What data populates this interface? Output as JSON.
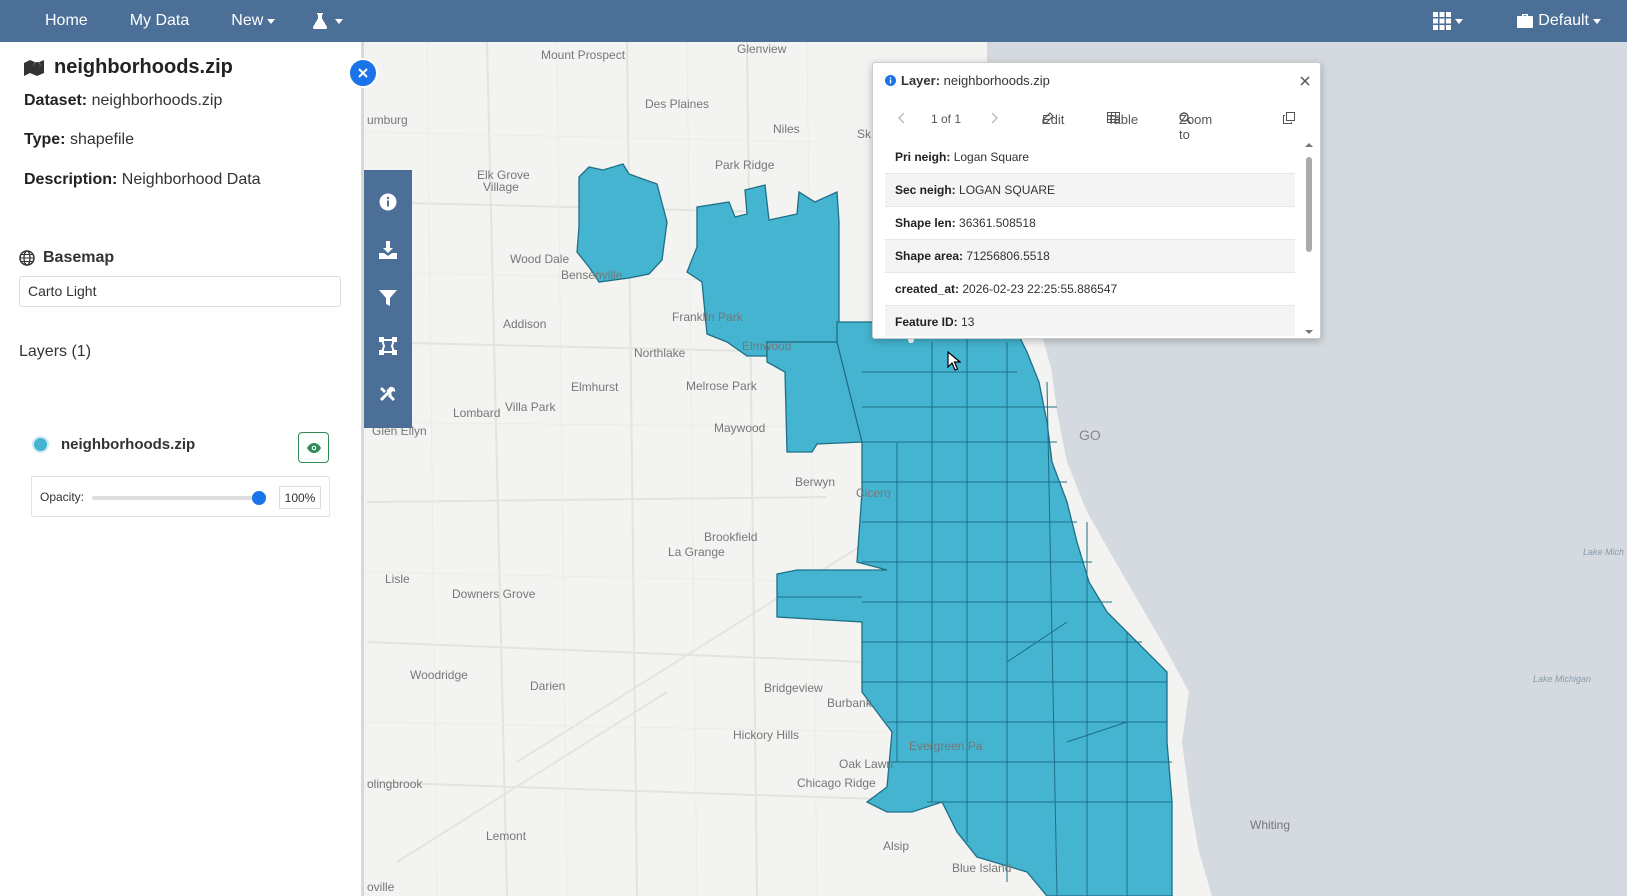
{
  "navbar": {
    "home": "Home",
    "my_data": "My Data",
    "new": "New",
    "workspace": "Default"
  },
  "sidebar": {
    "title": "neighborhoods.zip",
    "dataset_label": "Dataset:",
    "dataset_value": "neighborhoods.zip",
    "type_label": "Type:",
    "type_value": "shapefile",
    "description_label": "Description:",
    "description_value": "Neighborhood Data",
    "basemap_heading": "Basemap",
    "basemap_value": "Carto Light",
    "layers_heading": "Layers (1)",
    "layer_name": "neighborhoods.zip",
    "opacity_label": "Opacity:",
    "opacity_value": "100%"
  },
  "popup": {
    "title_label": "Layer:",
    "title_value": "neighborhoods.zip",
    "pager": "1 of 1",
    "edit": "Edit",
    "table": "Table",
    "zoom_to": "Zoom to",
    "rows": [
      {
        "key": "Pri neigh:",
        "value": "Logan Square"
      },
      {
        "key": "Sec neigh:",
        "value": "LOGAN SQUARE"
      },
      {
        "key": "Shape len:",
        "value": "36361.508518"
      },
      {
        "key": "Shape area:",
        "value": "71256806.5518"
      },
      {
        "key": "created_at:",
        "value": "2026-02-23 22:25:55.886547"
      },
      {
        "key": "Feature ID:",
        "value": "13"
      }
    ]
  },
  "map": {
    "places": [
      "Glenview",
      "Mount Prospect",
      "Des Plaines",
      "Niles",
      "Sk",
      "umburg",
      "Park Ridge",
      "Elk Grove",
      "Village",
      "Wood Dale",
      "Bensenville",
      "Franklin Park",
      "Addison",
      "Elmwood",
      "Northlake",
      "Elmhurst",
      "Melrose Park",
      "Villa Park",
      "Lombard",
      "Maywood",
      "Glen Ellyn",
      "GO",
      "Berwyn",
      "Cicero",
      "Brookfield",
      "La Grange",
      "Lisle",
      "Downers Grove",
      "Woodridge",
      "Darien",
      "Bridgeview",
      "Burbank",
      "Hickory Hills",
      "Evergreen Pa",
      "Oak Lawn",
      "Chicago Ridge",
      "olingbrook",
      "Lemont",
      "Alsip",
      "Blue Island",
      "Whiting",
      "oville",
      "Lake Mich",
      "Lake Michigan"
    ],
    "layer_color": "#44b4d0",
    "water_color": "#d4dadf"
  }
}
